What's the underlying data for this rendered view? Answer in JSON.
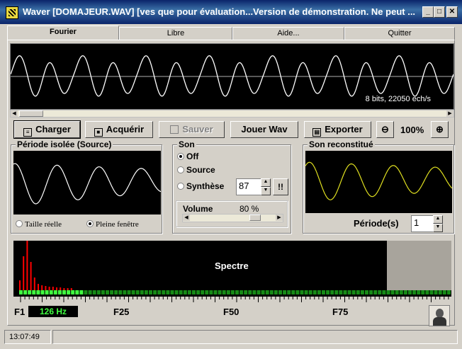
{
  "window": {
    "title": "Waver [DOMAJEUR.WAV] [ves que pour évaluation...Version de démonstration. Ne peut ...",
    "minimize_glyph": "_",
    "maximize_glyph": "□",
    "close_glyph": "✕"
  },
  "tabs": [
    {
      "label": "Fourier",
      "active": true
    },
    {
      "label": "Libre",
      "active": false
    },
    {
      "label": "Aide...",
      "active": false
    },
    {
      "label": "Quitter",
      "active": false
    }
  ],
  "waveform": {
    "info": "8 bits, 22050 ech/s"
  },
  "toolbar": {
    "charger": "Charger",
    "acquerir": "Acquérir",
    "sauver": "Sauver",
    "jouer_wav": "Jouer Wav",
    "exporter": "Exporter",
    "zoom_level": "100%"
  },
  "periode_isolee": {
    "title": "Période isolée (Source)",
    "option_taille": "Taille réelle",
    "option_pleine": "Pleine fenêtre",
    "selected": "Pleine fenêtre"
  },
  "son": {
    "title": "Son",
    "off": "Off",
    "source": "Source",
    "synthese": "Synthèse",
    "selected": "Off",
    "synthese_value": "87",
    "bang_button": "!!",
    "volume_label": "Volume",
    "volume_value": "80 %",
    "volume_level": 0.8
  },
  "son_reconstitue": {
    "title": "Son reconstitué",
    "periode_label": "Période(s)",
    "periode_value": "1"
  },
  "spectrum": {
    "label": "Spectre",
    "f1_label": "F1",
    "frequency": "126 Hz",
    "f25_label": "F25",
    "f50_label": "F50",
    "f75_label": "F75"
  },
  "status": {
    "time": "13:07:49"
  },
  "colors": {
    "title_bar": "#0a246a",
    "waveform": "#ffffff",
    "reconstructed_wave": "#e0e020",
    "spectrum_bar": "#ff0000",
    "spectrum_marker": "#20c020",
    "frequency_text": "#40ff40"
  }
}
